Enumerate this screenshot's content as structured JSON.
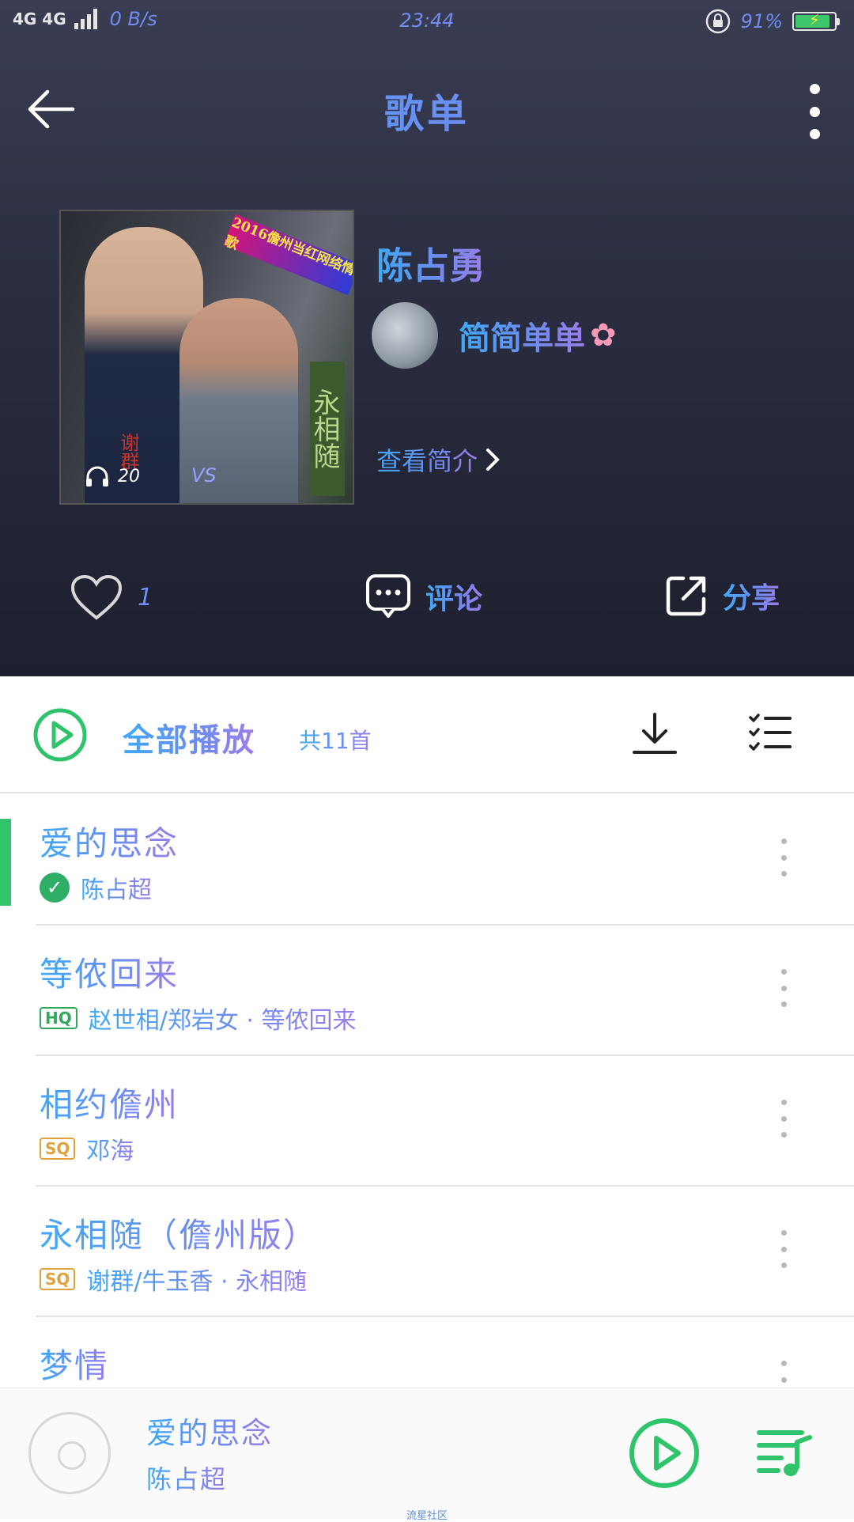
{
  "status_bar": {
    "network": "4G 4G",
    "speed": "0 B/s",
    "time": "23:44",
    "battery": "91%",
    "battery_level": 0.91
  },
  "header": {
    "title": "歌单",
    "playlist_name": "陈占勇",
    "creator": "简简单单",
    "intro_label": "查看简介",
    "cover": {
      "banner": "2016儋州当红网络情歌",
      "vertical_text": "永相随",
      "names": "谢群",
      "vs": "VS",
      "play_count": "20"
    },
    "actions": {
      "like_count": "1",
      "comment_label": "评论",
      "share_label": "分享"
    }
  },
  "playall": {
    "label": "全部播放",
    "count": "共11首"
  },
  "songs": [
    {
      "title": "爱的思念",
      "subtitle": "陈占超",
      "badge": "",
      "active": true
    },
    {
      "title": "等侬回来",
      "subtitle": "赵世相/郑岩女 · 等侬回来",
      "badge": "HQ",
      "active": false
    },
    {
      "title": "相约儋州",
      "subtitle": "邓海",
      "badge": "SQ",
      "active": false
    },
    {
      "title": "永相随（儋州版）",
      "subtitle": "谢群/牛玉香 · 永相随",
      "badge": "SQ",
      "active": false
    },
    {
      "title": "梦情",
      "subtitle": "",
      "badge": "",
      "active": false
    }
  ],
  "player": {
    "title": "爱的思念",
    "artist": "陈占超",
    "watermark": "流星社区"
  },
  "colors": {
    "accent_green": "#2fc46b",
    "text_gradient_start": "#3fa9f5",
    "text_gradient_end": "#9b7de8",
    "header_bg": "#2a2d40"
  }
}
